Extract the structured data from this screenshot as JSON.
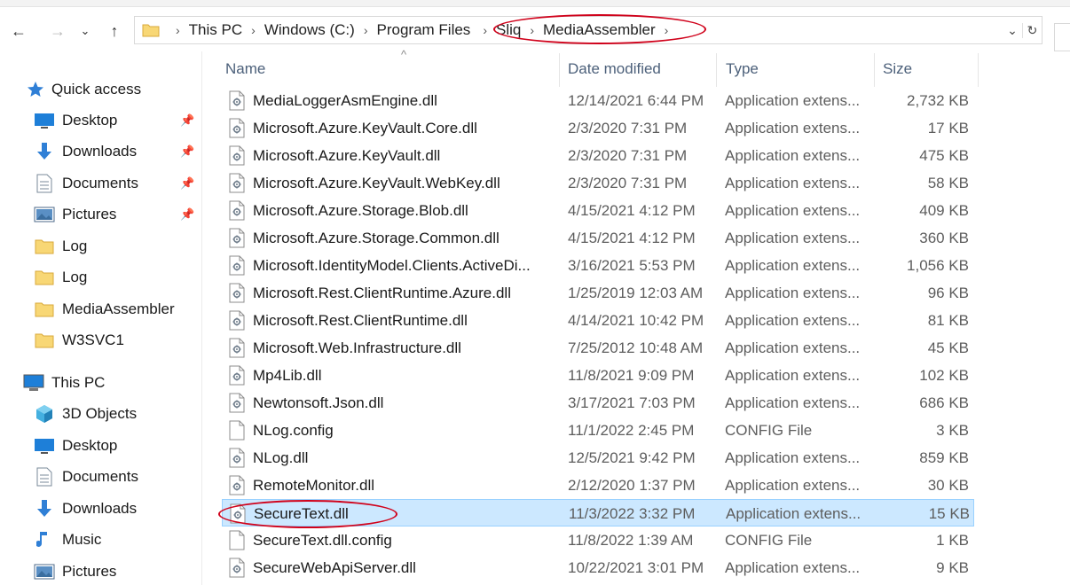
{
  "window": {
    "title": "MediaAssembler"
  },
  "breadcrumb": [
    "This PC",
    "Windows (C:)",
    "Program Files",
    "Sliq",
    "MediaAssembler"
  ],
  "nav": {
    "back": "←",
    "forward": "→",
    "recent": "⌄",
    "up": "↑",
    "dropdown": "⌄",
    "refresh": "↻"
  },
  "sidebar": {
    "quick_access": {
      "label": "Quick access",
      "items": [
        {
          "label": "Desktop",
          "icon": "desktop-icon",
          "pinned": true
        },
        {
          "label": "Downloads",
          "icon": "download-icon",
          "pinned": true
        },
        {
          "label": "Documents",
          "icon": "document-icon",
          "pinned": true
        },
        {
          "label": "Pictures",
          "icon": "pictures-icon",
          "pinned": true
        },
        {
          "label": "Log",
          "icon": "folder-icon",
          "pinned": false
        },
        {
          "label": "Log",
          "icon": "folder-icon",
          "pinned": false
        },
        {
          "label": "MediaAssembler",
          "icon": "folder-icon",
          "pinned": false
        },
        {
          "label": "W3SVC1",
          "icon": "folder-icon",
          "pinned": false
        }
      ]
    },
    "this_pc": {
      "label": "This PC",
      "items": [
        {
          "label": "3D Objects",
          "icon": "cube-icon"
        },
        {
          "label": "Desktop",
          "icon": "desktop-icon"
        },
        {
          "label": "Documents",
          "icon": "document-icon"
        },
        {
          "label": "Downloads",
          "icon": "download-icon"
        },
        {
          "label": "Music",
          "icon": "music-icon"
        },
        {
          "label": "Pictures",
          "icon": "pictures-icon"
        }
      ]
    }
  },
  "columns": {
    "name": "Name",
    "date": "Date modified",
    "type": "Type",
    "size": "Size"
  },
  "files": [
    {
      "name": "MediaLoggerAsmEngine.dll",
      "date": "12/14/2021 6:44 PM",
      "type": "Application extens...",
      "size": "2,732 KB",
      "kind": "dll"
    },
    {
      "name": "Microsoft.Azure.KeyVault.Core.dll",
      "date": "2/3/2020 7:31 PM",
      "type": "Application extens...",
      "size": "17 KB",
      "kind": "dll"
    },
    {
      "name": "Microsoft.Azure.KeyVault.dll",
      "date": "2/3/2020 7:31 PM",
      "type": "Application extens...",
      "size": "475 KB",
      "kind": "dll"
    },
    {
      "name": "Microsoft.Azure.KeyVault.WebKey.dll",
      "date": "2/3/2020 7:31 PM",
      "type": "Application extens...",
      "size": "58 KB",
      "kind": "dll"
    },
    {
      "name": "Microsoft.Azure.Storage.Blob.dll",
      "date": "4/15/2021 4:12 PM",
      "type": "Application extens...",
      "size": "409 KB",
      "kind": "dll"
    },
    {
      "name": "Microsoft.Azure.Storage.Common.dll",
      "date": "4/15/2021 4:12 PM",
      "type": "Application extens...",
      "size": "360 KB",
      "kind": "dll"
    },
    {
      "name": "Microsoft.IdentityModel.Clients.ActiveDi...",
      "date": "3/16/2021 5:53 PM",
      "type": "Application extens...",
      "size": "1,056 KB",
      "kind": "dll"
    },
    {
      "name": "Microsoft.Rest.ClientRuntime.Azure.dll",
      "date": "1/25/2019 12:03 AM",
      "type": "Application extens...",
      "size": "96 KB",
      "kind": "dll"
    },
    {
      "name": "Microsoft.Rest.ClientRuntime.dll",
      "date": "4/14/2021 10:42 PM",
      "type": "Application extens...",
      "size": "81 KB",
      "kind": "dll"
    },
    {
      "name": "Microsoft.Web.Infrastructure.dll",
      "date": "7/25/2012 10:48 AM",
      "type": "Application extens...",
      "size": "45 KB",
      "kind": "dll"
    },
    {
      "name": "Mp4Lib.dll",
      "date": "11/8/2021 9:09 PM",
      "type": "Application extens...",
      "size": "102 KB",
      "kind": "dll"
    },
    {
      "name": "Newtonsoft.Json.dll",
      "date": "3/17/2021 7:03 PM",
      "type": "Application extens...",
      "size": "686 KB",
      "kind": "dll"
    },
    {
      "name": "NLog.config",
      "date": "11/1/2022 2:45 PM",
      "type": "CONFIG File",
      "size": "3 KB",
      "kind": "config"
    },
    {
      "name": "NLog.dll",
      "date": "12/5/2021 9:42 PM",
      "type": "Application extens...",
      "size": "859 KB",
      "kind": "dll"
    },
    {
      "name": "RemoteMonitor.dll",
      "date": "2/12/2020 1:37 PM",
      "type": "Application extens...",
      "size": "30 KB",
      "kind": "dll"
    },
    {
      "name": "SecureText.dll",
      "date": "11/3/2022 3:32 PM",
      "type": "Application extens...",
      "size": "15 KB",
      "kind": "dll",
      "selected": true
    },
    {
      "name": "SecureText.dll.config",
      "date": "11/8/2022 1:39 AM",
      "type": "CONFIG File",
      "size": "1 KB",
      "kind": "config"
    },
    {
      "name": "SecureWebApiServer.dll",
      "date": "10/22/2021 3:01 PM",
      "type": "Application extens...",
      "size": "9 KB",
      "kind": "dll"
    }
  ],
  "colors": {
    "selection": "#cce8ff",
    "selection_border": "#99d1ff",
    "annotation": "#d0021b",
    "folder": "#f8d775",
    "header_text": "#4c607a"
  }
}
